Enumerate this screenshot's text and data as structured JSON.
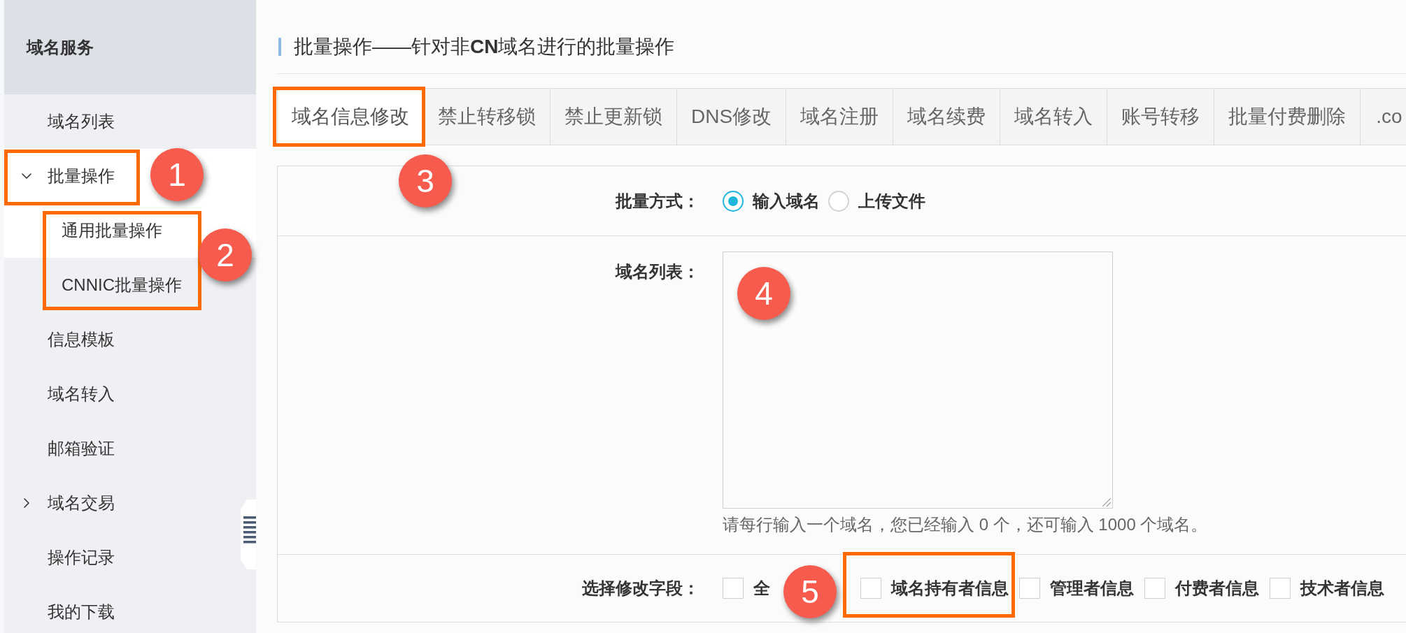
{
  "sidebar": {
    "title": "域名服务",
    "items": [
      {
        "label": "域名列表",
        "kind": "link",
        "selected": false
      },
      {
        "label": "批量操作",
        "kind": "group",
        "expanded": true,
        "selected": true,
        "children": [
          {
            "label": "通用批量操作",
            "selected": true
          },
          {
            "label": "CNNIC批量操作",
            "selected": false
          }
        ]
      },
      {
        "label": "信息模板",
        "kind": "link",
        "selected": false
      },
      {
        "label": "域名转入",
        "kind": "link",
        "selected": false
      },
      {
        "label": "邮箱验证",
        "kind": "link",
        "selected": false
      },
      {
        "label": "域名交易",
        "kind": "group",
        "expanded": false,
        "selected": false
      },
      {
        "label": "操作记录",
        "kind": "link",
        "selected": false
      },
      {
        "label": "我的下载",
        "kind": "link",
        "selected": false
      }
    ]
  },
  "page": {
    "title": "批量操作——针对非**CN**域名进行的批量操作"
  },
  "tabs": [
    {
      "label": "域名信息修改",
      "selected": true
    },
    {
      "label": "禁止转移锁",
      "selected": false
    },
    {
      "label": "禁止更新锁",
      "selected": false
    },
    {
      "label": "DNS修改",
      "selected": false
    },
    {
      "label": "域名注册",
      "selected": false
    },
    {
      "label": "域名续费",
      "selected": false
    },
    {
      "label": "域名转入",
      "selected": false
    },
    {
      "label": "账号转移",
      "selected": false
    },
    {
      "label": "批量付费删除",
      "selected": false
    },
    {
      "label": ".co",
      "selected": false
    }
  ],
  "form": {
    "mode": {
      "label": "批量方式：",
      "options": [
        {
          "label": "输入域名",
          "selected": true
        },
        {
          "label": "上传文件",
          "selected": false
        }
      ]
    },
    "domain_list": {
      "label": "域名列表：",
      "hint": "请每行输入一个域名，您已经输入 0 个，还可输入 1000 个域名。"
    },
    "fields": {
      "label": "选择修改字段：",
      "options": [
        {
          "label": "全",
          "checked": false
        },
        {
          "label": "域名持有者信息",
          "checked": false
        },
        {
          "label": "管理者信息",
          "checked": false
        },
        {
          "label": "付费者信息",
          "checked": false
        },
        {
          "label": "技术者信息",
          "checked": false
        }
      ]
    }
  },
  "annotations": [
    {
      "number": "1",
      "framed": true
    },
    {
      "number": "2",
      "framed": true
    },
    {
      "number": "3",
      "framed": true
    },
    {
      "number": "4",
      "framed": false
    },
    {
      "number": "5",
      "framed": true
    }
  ]
}
